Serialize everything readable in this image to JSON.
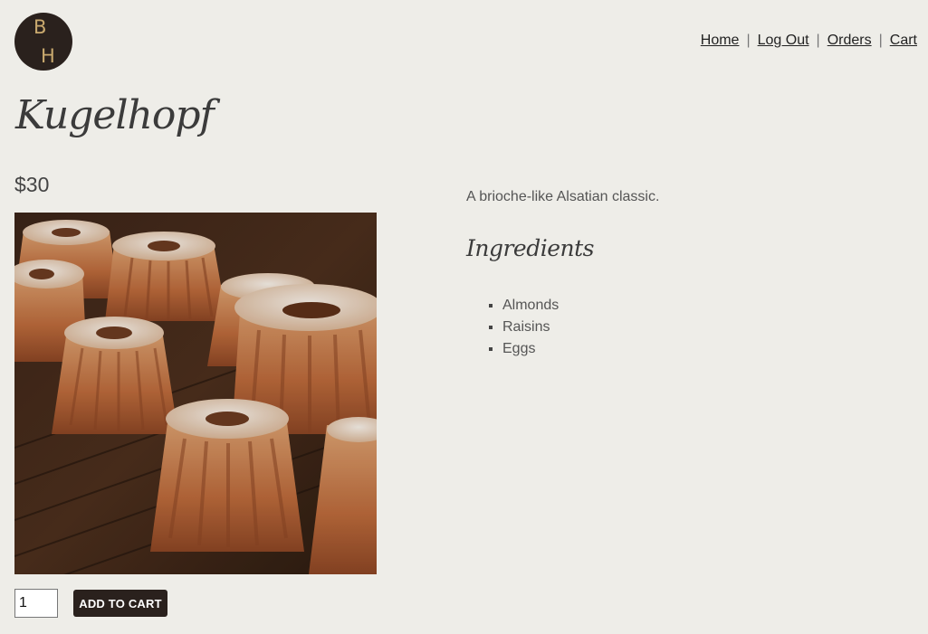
{
  "logo": {
    "letter_top": "B",
    "letter_bottom": "H"
  },
  "nav": {
    "items": [
      {
        "label": "Home"
      },
      {
        "label": "Log Out"
      },
      {
        "label": "Orders"
      },
      {
        "label": "Cart"
      }
    ],
    "separator": "|"
  },
  "product": {
    "name": "Kugelhopf",
    "price": "$30",
    "description": "A brioche-like Alsatian classic.",
    "ingredients_heading": "Ingredients",
    "ingredients": [
      "Almonds",
      "Raisins",
      "Eggs"
    ]
  },
  "cart_form": {
    "quantity": "1",
    "add_label": "ADD TO CART"
  },
  "colors": {
    "background": "#eeede8",
    "brand_dark": "#2a211d",
    "logo_letters": "#c9a96e"
  }
}
